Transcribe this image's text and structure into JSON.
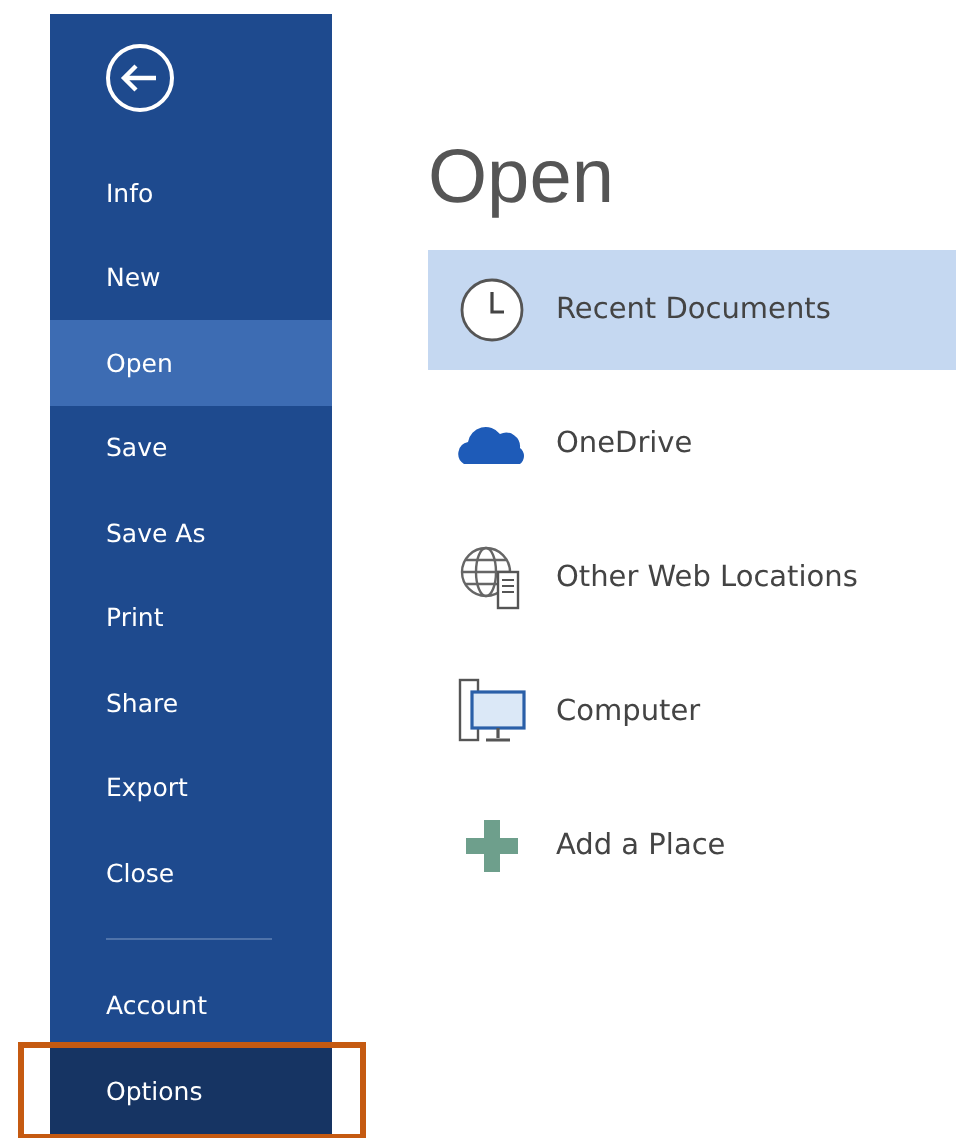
{
  "sidebar": {
    "back_button": {
      "kind": "back"
    },
    "items": [
      {
        "label": "Info",
        "selected": false,
        "highlighted": false
      },
      {
        "label": "New",
        "selected": false,
        "highlighted": false
      },
      {
        "label": "Open",
        "selected": true,
        "highlighted": false
      },
      {
        "label": "Save",
        "selected": false,
        "highlighted": false
      },
      {
        "label": "Save As",
        "selected": false,
        "highlighted": false
      },
      {
        "label": "Print",
        "selected": false,
        "highlighted": false
      },
      {
        "label": "Share",
        "selected": false,
        "highlighted": false
      },
      {
        "label": "Export",
        "selected": false,
        "highlighted": false
      },
      {
        "label": "Close",
        "selected": false,
        "highlighted": false
      },
      {
        "kind": "separator"
      },
      {
        "label": "Account",
        "selected": false,
        "highlighted": false
      },
      {
        "label": "Options",
        "selected": false,
        "highlighted": true
      }
    ]
  },
  "main": {
    "title": "Open",
    "places": [
      {
        "kind": "recent",
        "label": "Recent Documents",
        "selected": true
      },
      {
        "kind": "cloud",
        "label": "OneDrive",
        "selected": false
      },
      {
        "kind": "web",
        "label": "Other Web Locations",
        "selected": false
      },
      {
        "kind": "computer",
        "label": "Computer",
        "selected": false
      },
      {
        "kind": "add",
        "label": "Add a Place",
        "selected": false
      }
    ]
  }
}
